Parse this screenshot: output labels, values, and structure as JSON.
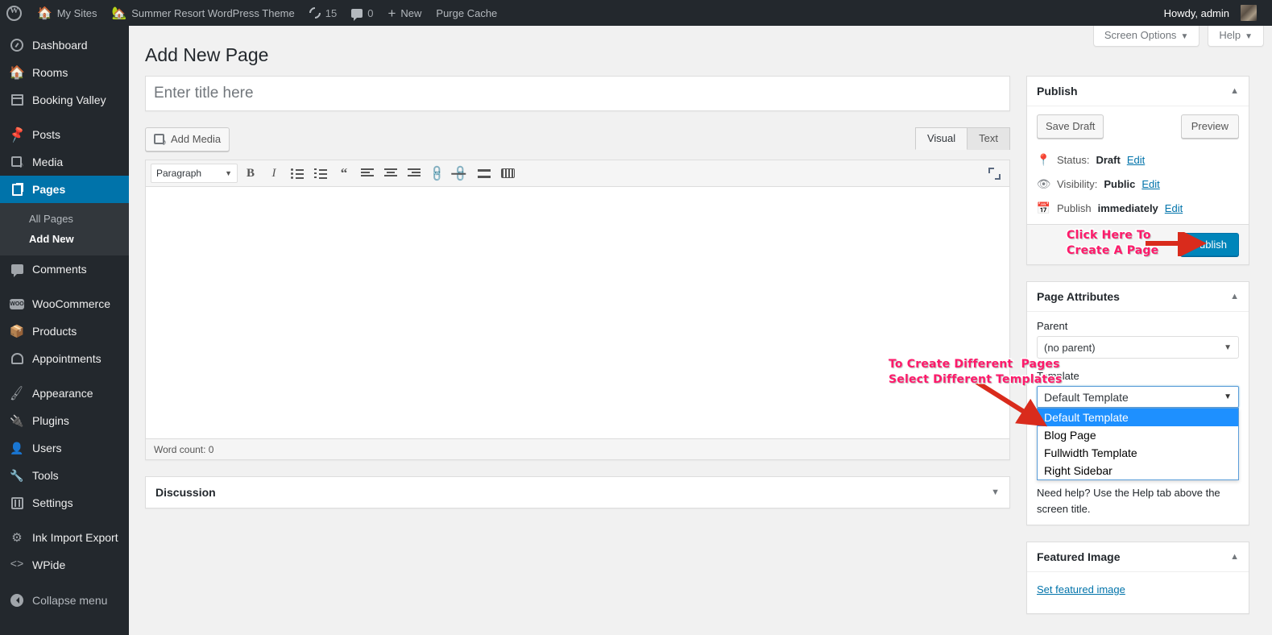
{
  "adminbar": {
    "logo_icon": "wordpress-logo-icon",
    "items": [
      {
        "label": "My Sites",
        "icon": "sites-house-icon"
      },
      {
        "label": "Summer Resort WordPress Theme",
        "icon": "site-house-icon"
      },
      {
        "label": "15",
        "icon": "updates-refresh-icon"
      },
      {
        "label": "0",
        "icon": "comments-bubble-icon"
      },
      {
        "label": "New",
        "icon": "plus-icon"
      },
      {
        "label": "Purge Cache",
        "icon": ""
      }
    ],
    "howdy": "Howdy, admin"
  },
  "sidebar": {
    "items": [
      {
        "label": "Dashboard",
        "icon": "dashboard-icon",
        "current": false,
        "sep_after": false
      },
      {
        "label": "Rooms",
        "icon": "home-icon",
        "current": false,
        "sep_after": false
      },
      {
        "label": "Booking Valley",
        "icon": "calendar-icon",
        "current": false,
        "sep_after": true
      },
      {
        "label": "Posts",
        "icon": "pin-icon",
        "current": false,
        "sep_after": false
      },
      {
        "label": "Media",
        "icon": "media-icon",
        "current": false,
        "sep_after": false
      },
      {
        "label": "Pages",
        "icon": "pages-icon",
        "current": true,
        "sep_after": false
      },
      {
        "label": "Comments",
        "icon": "comment-icon",
        "current": false,
        "sep_after": true
      },
      {
        "label": "WooCommerce",
        "icon": "woocommerce-icon",
        "current": false,
        "sep_after": false
      },
      {
        "label": "Products",
        "icon": "box-icon",
        "current": false,
        "sep_after": false
      },
      {
        "label": "Appointments",
        "icon": "appointments-icon",
        "current": false,
        "sep_after": true
      },
      {
        "label": "Appearance",
        "icon": "brush-icon",
        "current": false,
        "sep_after": false
      },
      {
        "label": "Plugins",
        "icon": "plug-icon",
        "current": false,
        "sep_after": false
      },
      {
        "label": "Users",
        "icon": "user-icon",
        "current": false,
        "sep_after": false
      },
      {
        "label": "Tools",
        "icon": "wrench-icon",
        "current": false,
        "sep_after": false
      },
      {
        "label": "Settings",
        "icon": "settings-icon",
        "current": false,
        "sep_after": true
      },
      {
        "label": "Ink Import Export",
        "icon": "gear-icon",
        "current": false,
        "sep_after": false
      },
      {
        "label": "WPide",
        "icon": "code-icon",
        "current": false,
        "sep_after": false
      }
    ],
    "submenu": [
      {
        "label": "All Pages",
        "current": false
      },
      {
        "label": "Add New",
        "current": true
      }
    ],
    "collapse": {
      "label": "Collapse menu",
      "icon": "collapse-arrow-icon"
    }
  },
  "screen_meta": {
    "screen_options": "Screen Options",
    "help": "Help",
    "caret": "▼"
  },
  "page": {
    "title": "Add New Page"
  },
  "title_field": {
    "placeholder": "Enter title here",
    "value": ""
  },
  "editor": {
    "add_media": "Add Media",
    "tabs": [
      {
        "label": "Visual",
        "active": true
      },
      {
        "label": "Text",
        "active": false
      }
    ],
    "format_select": "Paragraph",
    "caret": "▼",
    "toolbar_buttons": [
      "bold-icon",
      "italic-icon",
      "bulleted-list-icon",
      "numbered-list-icon",
      "blockquote-icon",
      "align-left-icon",
      "align-center-icon",
      "align-right-icon",
      "insert-link-icon",
      "unlink-icon",
      "insert-read-more-icon",
      "keyboard-shortcuts-icon"
    ],
    "fullscreen_icon": "distraction-free-icon",
    "content": "",
    "word_count": "Word count: 0"
  },
  "discussion": {
    "title": "Discussion",
    "toggle": "▼"
  },
  "publish_box": {
    "title": "Publish",
    "toggle": "▲",
    "save_draft": "Save Draft",
    "preview": "Preview",
    "status_label": "Status:",
    "status_value": "Draft",
    "status_edit": "Edit",
    "visibility_label": "Visibility:",
    "visibility_value": "Public",
    "visibility_edit": "Edit",
    "schedule_label": "Publish",
    "schedule_value": "immediately",
    "schedule_edit": "Edit",
    "publish_button": "Publish",
    "status_icon": "pin-marker-icon",
    "visibility_icon": "eye-icon",
    "schedule_icon": "calendar-icon"
  },
  "page_attributes": {
    "title": "Page Attributes",
    "toggle": "▲",
    "parent_label": "Parent",
    "parent_value": "(no parent)",
    "template_label": "Template",
    "template_value": "Default Template",
    "template_options": [
      {
        "label": "Default Template",
        "selected": true
      },
      {
        "label": "Blog Page",
        "selected": false
      },
      {
        "label": "Fullwidth Template",
        "selected": false
      },
      {
        "label": "Right Sidebar",
        "selected": false
      }
    ],
    "help_text": "Need help? Use the Help tab above the screen title.",
    "caret": "▼"
  },
  "featured_image": {
    "title": "Featured Image",
    "toggle": "▲",
    "link": "Set featured image"
  },
  "annotations": [
    {
      "text": "Click Here To\nCreate A Page",
      "color": "#ff1a6b"
    },
    {
      "text": "To Create Different  Pages\nSelect Different Templates",
      "color": "#ff1a6b"
    }
  ],
  "colors": {
    "accent_blue": "#0073aa",
    "publish_blue": "#0085ba",
    "annotation_pink": "#ff1a6b",
    "arrow_red": "#d92b1c",
    "admin_dark": "#23282d",
    "submenu_dark": "#32373c",
    "page_bg": "#f1f1f1"
  }
}
